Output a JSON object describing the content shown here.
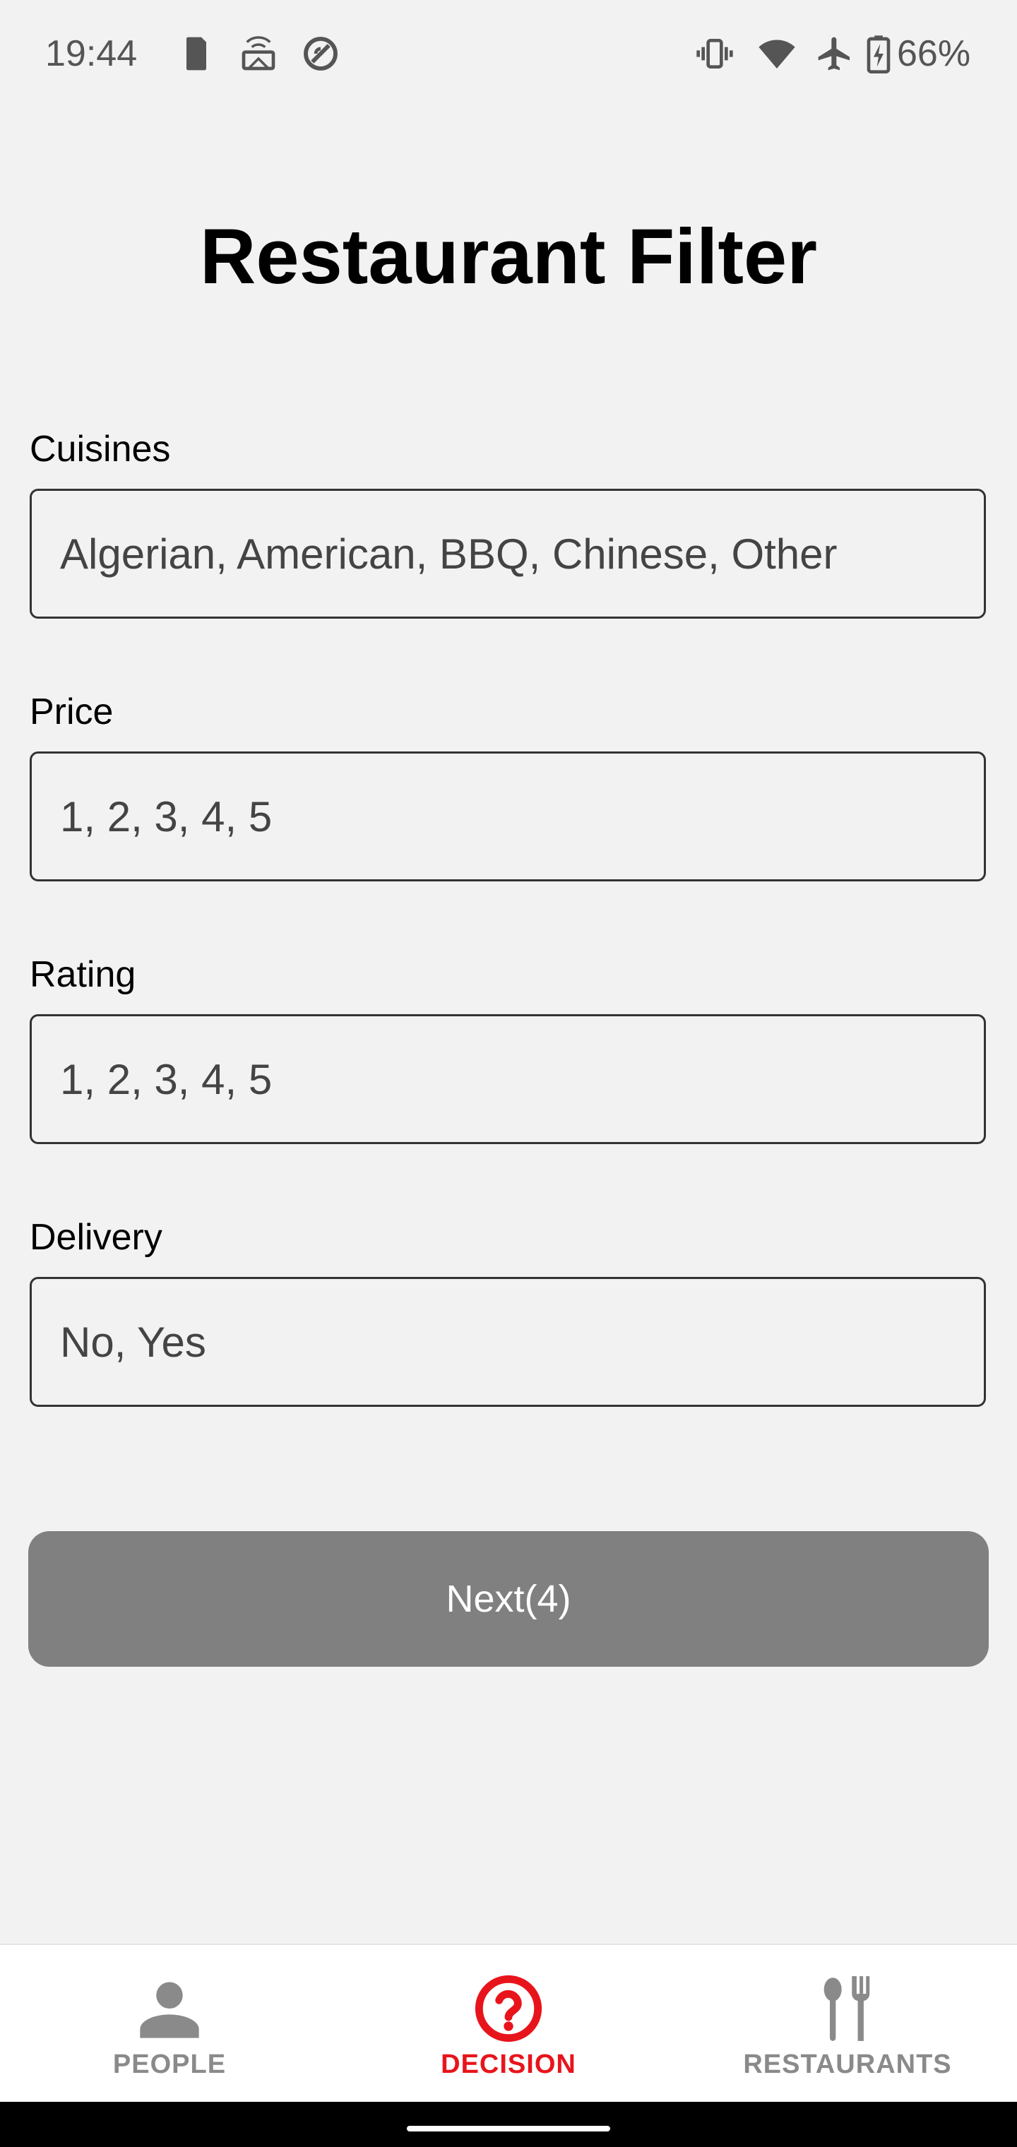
{
  "status_bar": {
    "time": "19:44",
    "battery_percent": "66%",
    "left_icons": [
      "phone-icon",
      "cast-icon",
      "do-not-disturb-icon"
    ],
    "right_icons": [
      "vibrate-icon",
      "wifi-icon",
      "airplane-icon",
      "battery-charging-icon"
    ]
  },
  "page": {
    "title": "Restaurant Filter"
  },
  "fields": {
    "cuisines": {
      "label": "Cuisines",
      "value": "Algerian, American, BBQ, Chinese, Other"
    },
    "price": {
      "label": "Price",
      "value": "1, 2, 3, 4, 5"
    },
    "rating": {
      "label": "Rating",
      "value": "1, 2, 3, 4, 5"
    },
    "delivery": {
      "label": "Delivery",
      "value": "No, Yes"
    }
  },
  "actions": {
    "next_label": "Next(4)"
  },
  "bottom_nav": {
    "items": [
      {
        "label": "PEOPLE",
        "icon": "person-icon",
        "active": false
      },
      {
        "label": "DECISION",
        "icon": "question-circle-icon",
        "active": true
      },
      {
        "label": "RESTAURANTS",
        "icon": "utensils-icon",
        "active": false
      }
    ]
  },
  "colors": {
    "accent": "#e8141b",
    "inactive": "#8a8a8a",
    "button": "#808080",
    "background": "#f2f2f2"
  }
}
